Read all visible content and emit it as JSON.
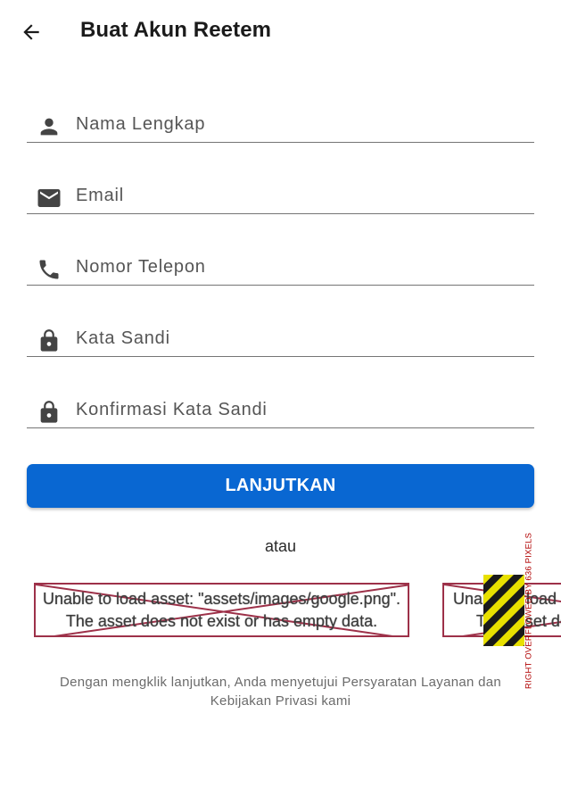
{
  "appbar": {
    "title": "Buat Akun Reetem",
    "back_icon": "arrow-left-icon"
  },
  "form": {
    "fields": [
      {
        "icon": "person-icon",
        "placeholder": "Nama Lengkap"
      },
      {
        "icon": "mail-icon",
        "placeholder": "Email"
      },
      {
        "icon": "phone-icon",
        "placeholder": "Nomor Telepon"
      },
      {
        "icon": "lock-icon",
        "placeholder": "Kata Sandi"
      },
      {
        "icon": "lock-icon",
        "placeholder": "Konfirmasi Kata Sandi"
      }
    ],
    "submit_label": "LANJUTKAN",
    "or_label": "atau"
  },
  "social": {
    "error_line1": "Unable to load asset: \"assets/images/google.png\".",
    "error_line2": "The asset does not exist or has empty data.",
    "overflow_label": "RIGHT OVERFLOWED BY 636 PIXELS"
  },
  "terms": "Dengan mengklik lanjutkan, Anda menyetujui Persyaratan Layanan dan Kebijakan Privasi kami",
  "colors": {
    "primary": "#0967d2",
    "error_border": "#9d3149",
    "overflow_text": "#b00000"
  }
}
